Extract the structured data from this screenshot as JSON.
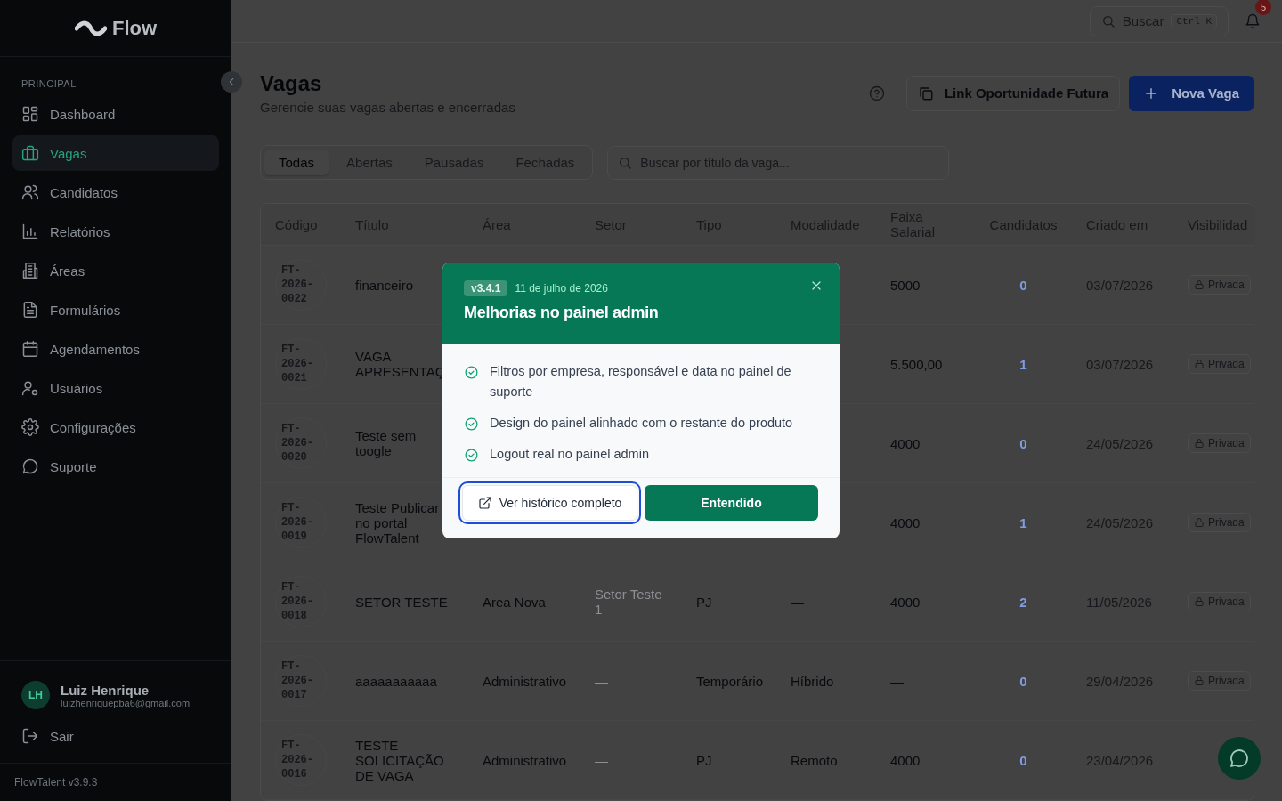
{
  "sidebar": {
    "logo": "Flow",
    "section_label": "PRINCIPAL",
    "items": [
      {
        "label": "Dashboard",
        "selected": false
      },
      {
        "label": "Vagas",
        "selected": true
      },
      {
        "label": "Candidatos",
        "selected": false
      },
      {
        "label": "Relatórios",
        "selected": false
      },
      {
        "label": "Áreas",
        "selected": false
      },
      {
        "label": "Formulários",
        "selected": false
      },
      {
        "label": "Agendamentos",
        "selected": false
      },
      {
        "label": "Usuários",
        "selected": false
      },
      {
        "label": "Configurações",
        "selected": false
      },
      {
        "label": "Suporte",
        "selected": false
      }
    ],
    "user": {
      "initials": "LH",
      "name": "Luiz Henrique",
      "email": "luizhenriquepba6@gmail.com"
    },
    "logout": "Sair",
    "version": "FlowTalent v3.9.3"
  },
  "topbar": {
    "search": "Buscar",
    "shortcut": "Ctrl K",
    "notifications": "5"
  },
  "header": {
    "title": "Vagas",
    "subtitle": "Gerencie suas vagas abertas e encerradas",
    "link_button": "Link Oportunidade Futura",
    "new_button": "Nova Vaga"
  },
  "tabs": [
    {
      "label": "Todas",
      "selected": true
    },
    {
      "label": "Abertas",
      "selected": false
    },
    {
      "label": "Pausadas",
      "selected": false
    },
    {
      "label": "Fechadas",
      "selected": false
    }
  ],
  "search": {
    "placeholder": "Buscar por título da vaga..."
  },
  "table": {
    "columns": [
      "Código",
      "Título",
      "Área",
      "Setor",
      "Tipo",
      "Modalidade",
      "Faixa Salarial",
      "Candidatos",
      "Criado em",
      "Visibilidad"
    ],
    "rows": [
      {
        "code": "FT-2026-0022",
        "title": "financeiro",
        "salary": "5000",
        "candidates": "0",
        "created": "03/07/2026",
        "visibility": "Privada"
      },
      {
        "code": "FT-2026-0021",
        "title": "VAGA APRESENTAÇ",
        "salary": "5.500,00",
        "candidates": "1",
        "created": "03/07/2026",
        "visibility": "Privada"
      },
      {
        "code": "FT-2026-0020",
        "title": "Teste sem toogle",
        "salary": "4000",
        "candidates": "0",
        "created": "24/05/2026",
        "visibility": "Privada"
      },
      {
        "code": "FT-2026-0019",
        "title": "Teste Publicar no portal FlowTalent",
        "salary": "4000",
        "candidates": "1",
        "created": "24/05/2026",
        "visibility": "Privada"
      },
      {
        "code": "FT-2026-0018",
        "title": "SETOR TESTE",
        "area": "Area Nova",
        "sector": "Setor Teste 1",
        "type": "PJ",
        "mode": "—",
        "salary": "4000",
        "candidates": "2",
        "created": "11/05/2026",
        "visibility": "Privada"
      },
      {
        "code": "FT-2026-0017",
        "title": "aaaaaaaaaaa",
        "area": "Administrativo",
        "sector": "—",
        "type": "Temporário",
        "mode": "Híbrido",
        "salary": "—",
        "candidates": "0",
        "created": "29/04/2026",
        "visibility": "Privada"
      },
      {
        "code": "FT-2026-0016",
        "title": "TESTE SOLICITAÇÃO DE VAGA",
        "area": "Administrativo",
        "sector": "—",
        "type": "PJ",
        "mode": "Remoto",
        "salary": "4000",
        "candidates": "0",
        "created": "23/04/2026"
      }
    ]
  },
  "modal": {
    "version": "v3.4.1",
    "date": "11 de julho de 2026",
    "title": "Melhorias no painel admin",
    "items": [
      "Filtros por empresa, responsável e data no painel de suporte",
      "Design do painel alinhado com o restante do produto",
      "Logout real no painel admin"
    ],
    "secondary_button": "Ver histórico completo",
    "primary_button": "Entendido"
  }
}
